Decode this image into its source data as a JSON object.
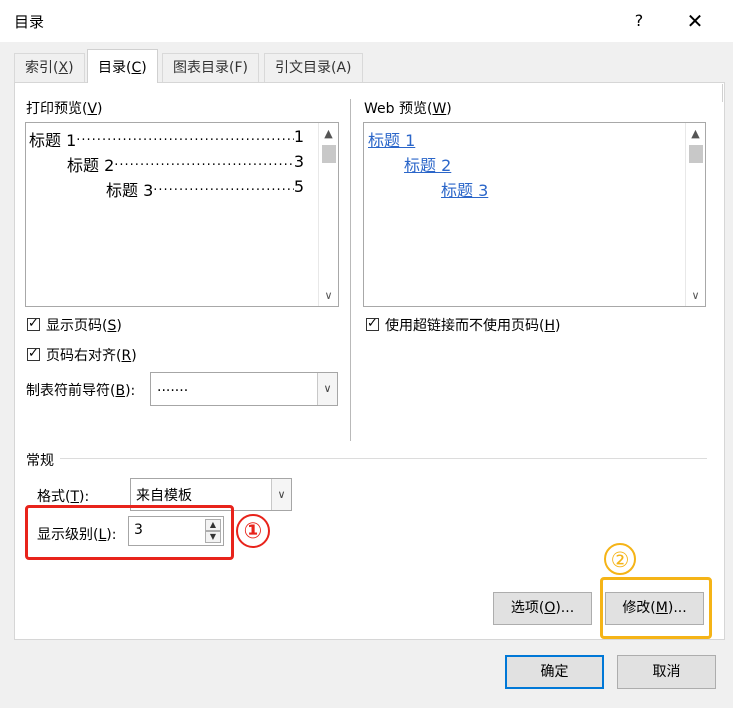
{
  "window": {
    "title": "目录",
    "help_glyph": "?",
    "close_glyph": "✕"
  },
  "tabs": [
    {
      "label": "索引(",
      "key": "X",
      "suffix": ")"
    },
    {
      "label": "目录(",
      "key": "C",
      "suffix": ")"
    },
    {
      "label": "图表目录(F)",
      "key": "",
      "suffix": ""
    },
    {
      "label": "引文目录(A)",
      "key": "",
      "suffix": ""
    }
  ],
  "print_preview": {
    "label": "打印预览(",
    "key": "V",
    "suffix": ")",
    "lines": [
      {
        "text": "标题 1",
        "page": "1"
      },
      {
        "text": "标题 2",
        "page": "3"
      },
      {
        "text": "标题 3",
        "page": "5"
      }
    ],
    "dots": "................................................................................"
  },
  "web_preview": {
    "label": "Web 预览(",
    "key": "W",
    "suffix": ")",
    "links": [
      "标题 1",
      "标题 2",
      "标题 3"
    ]
  },
  "options": {
    "show_page_numbers": {
      "label": "显示页码(",
      "key": "S",
      "suffix": ")",
      "checked": true
    },
    "right_align": {
      "label": "页码右对齐(",
      "key": "R",
      "suffix": ")",
      "checked": true
    },
    "use_hyperlinks": {
      "label": "使用超链接而不使用页码(",
      "key": "H",
      "suffix": ")",
      "checked": true
    },
    "tab_leader": {
      "label": "制表符前导符(",
      "key": "B",
      "suffix": "):",
      "value": "......."
    }
  },
  "general": {
    "section_label": "常规",
    "formats": {
      "label": "格式(",
      "key": "T",
      "suffix": "):",
      "value": "来自模板"
    },
    "show_levels": {
      "label": "显示级别(",
      "key": "L",
      "suffix": "):",
      "value": "3"
    }
  },
  "buttons": {
    "options": {
      "label": "选项(",
      "key": "O",
      "suffix": ")..."
    },
    "modify": {
      "label": "修改(",
      "key": "M",
      "suffix": ")..."
    },
    "ok": "确定",
    "cancel": "取消"
  },
  "annotations": {
    "step1": "①",
    "step2": "②"
  },
  "colors": {
    "step1": "#e8231b",
    "step2": "#f5b417",
    "link": "#2b66c9",
    "default_button_border": "#0078d7"
  },
  "icons": {
    "scroll_up": "▲",
    "scroll_down": "∨",
    "dropdown": "∨",
    "spin_up": "▲",
    "spin_down": "▼"
  }
}
